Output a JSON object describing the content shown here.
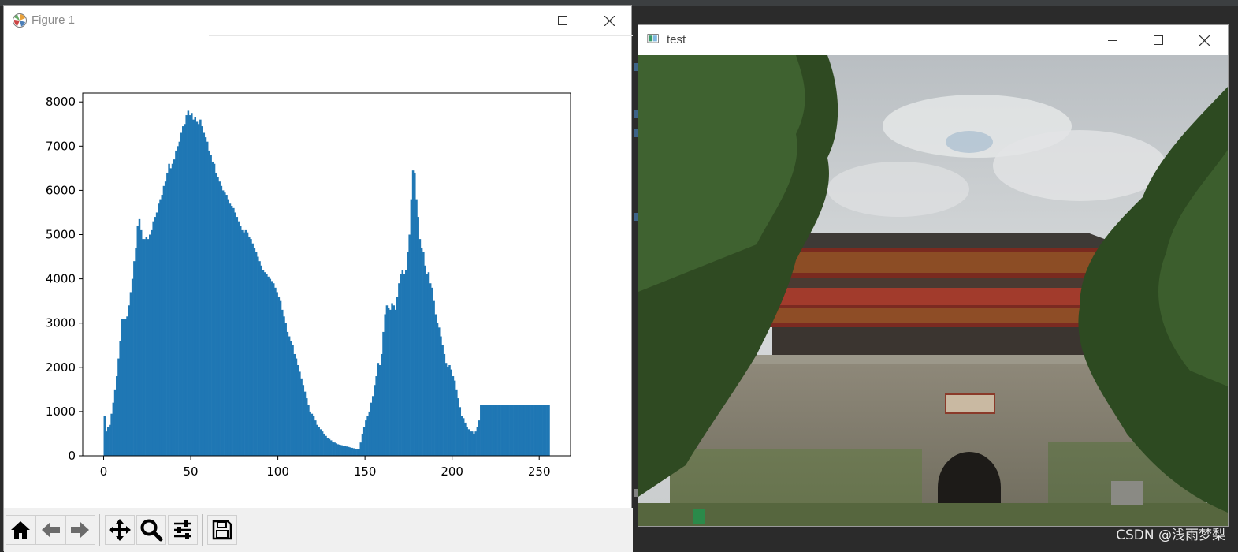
{
  "figure_window": {
    "title": "Figure 1",
    "icons": {
      "app": "matplotlib-logo-icon",
      "minimize": "minimize-icon",
      "maximize": "maximize-icon",
      "close": "close-icon"
    }
  },
  "toolbar": {
    "buttons": [
      "home-icon",
      "back-icon",
      "forward-icon",
      "pan-icon",
      "zoom-icon",
      "configure-subplots-icon",
      "save-icon"
    ]
  },
  "colors": {
    "bars": "#1f77b4",
    "ide_background": "#2b2b2b"
  },
  "chart_data": {
    "type": "bar",
    "title": "",
    "xlabel": "",
    "ylabel": "",
    "xlim": [
      -12,
      268
    ],
    "ylim": [
      0,
      8200
    ],
    "x_ticks": [
      "0",
      "50",
      "100",
      "150",
      "200",
      "250"
    ],
    "y_ticks": [
      "0",
      "1000",
      "2000",
      "3000",
      "4000",
      "5000",
      "6000",
      "7000",
      "8000"
    ],
    "grid": false,
    "legend": "none",
    "bin_width": 1,
    "x": [
      0,
      1,
      2,
      3,
      4,
      5,
      6,
      7,
      8,
      9,
      10,
      11,
      12,
      13,
      14,
      15,
      16,
      17,
      18,
      19,
      20,
      21,
      22,
      23,
      24,
      25,
      26,
      27,
      28,
      29,
      30,
      31,
      32,
      33,
      34,
      35,
      36,
      37,
      38,
      39,
      40,
      41,
      42,
      43,
      44,
      45,
      46,
      47,
      48,
      49,
      50,
      51,
      52,
      53,
      54,
      55,
      56,
      57,
      58,
      59,
      60,
      61,
      62,
      63,
      64,
      65,
      66,
      67,
      68,
      69,
      70,
      71,
      72,
      73,
      74,
      75,
      76,
      77,
      78,
      79,
      80,
      81,
      82,
      83,
      84,
      85,
      86,
      87,
      88,
      89,
      90,
      91,
      92,
      93,
      94,
      95,
      96,
      97,
      98,
      99,
      100,
      101,
      102,
      103,
      104,
      105,
      106,
      107,
      108,
      109,
      110,
      111,
      112,
      113,
      114,
      115,
      116,
      117,
      118,
      119,
      120,
      121,
      122,
      123,
      124,
      125,
      126,
      127,
      128,
      129,
      130,
      131,
      132,
      133,
      134,
      135,
      136,
      137,
      138,
      139,
      140,
      141,
      142,
      143,
      144,
      145,
      146,
      147,
      148,
      149,
      150,
      151,
      152,
      153,
      154,
      155,
      156,
      157,
      158,
      159,
      160,
      161,
      162,
      163,
      164,
      165,
      166,
      167,
      168,
      169,
      170,
      171,
      172,
      173,
      174,
      175,
      176,
      177,
      178,
      179,
      180,
      181,
      182,
      183,
      184,
      185,
      186,
      187,
      188,
      189,
      190,
      191,
      192,
      193,
      194,
      195,
      196,
      197,
      198,
      199,
      200,
      201,
      202,
      203,
      204,
      205,
      206,
      207,
      208,
      209,
      210,
      211,
      212,
      213,
      214,
      215,
      216,
      217,
      218,
      219,
      220,
      221,
      222,
      223,
      224,
      225,
      226,
      227,
      228,
      229,
      230,
      231,
      232,
      233,
      234,
      235,
      236,
      237,
      238,
      239,
      240,
      241,
      242,
      243,
      244,
      245,
      246,
      247,
      248,
      249,
      250,
      251,
      252,
      253,
      254,
      255
    ],
    "values": [
      900,
      550,
      650,
      700,
      950,
      1200,
      1500,
      1800,
      2200,
      2600,
      3100,
      3100,
      3100,
      3150,
      3400,
      3700,
      4000,
      4400,
      4700,
      5200,
      5350,
      5100,
      4900,
      4900,
      4950,
      4900,
      5000,
      5100,
      5300,
      5400,
      5500,
      5700,
      5800,
      5900,
      6100,
      6200,
      6400,
      6600,
      6500,
      6600,
      6700,
      6900,
      7000,
      7100,
      7300,
      7450,
      7500,
      7700,
      7800,
      7700,
      7750,
      7600,
      7650,
      7550,
      7500,
      7600,
      7450,
      7300,
      7200,
      7100,
      6900,
      6800,
      6650,
      6600,
      6400,
      6300,
      6200,
      6100,
      6000,
      5950,
      5900,
      5800,
      5700,
      5650,
      5600,
      5500,
      5400,
      5300,
      5200,
      5100,
      5050,
      5100,
      5050,
      4950,
      4900,
      4800,
      4700,
      4600,
      4500,
      4400,
      4300,
      4200,
      4150,
      4100,
      4050,
      4000,
      3950,
      3900,
      3800,
      3700,
      3600,
      3500,
      3300,
      3150,
      3000,
      2800,
      2700,
      2600,
      2500,
      2300,
      2200,
      2050,
      1900,
      1750,
      1600,
      1450,
      1300,
      1150,
      1000,
      950,
      900,
      800,
      700,
      650,
      600,
      550,
      500,
      450,
      400,
      380,
      350,
      320,
      300,
      280,
      260,
      250,
      240,
      230,
      220,
      210,
      200,
      190,
      180,
      170,
      160,
      150,
      150,
      300,
      500,
      650,
      800,
      900,
      1000,
      1200,
      1350,
      1600,
      1800,
      2100,
      2050,
      2300,
      2800,
      3200,
      3400,
      3350,
      3300,
      3450,
      3400,
      3300,
      3600,
      3900,
      4100,
      4200,
      4100,
      4200,
      4600,
      5000,
      5800,
      6450,
      6400,
      5800,
      5400,
      4900,
      4700,
      4600,
      4300,
      4100,
      4150,
      3900,
      3800,
      3500,
      3200,
      3000,
      2900,
      2700,
      2500,
      2300,
      2100,
      2000,
      2050,
      1950,
      1800,
      1700,
      1500,
      1300,
      1100,
      900,
      850,
      750,
      650,
      600,
      550,
      550,
      500,
      550,
      650,
      800,
      1150,
      1150,
      1150,
      1150,
      1150,
      1150,
      1150,
      1150,
      1150,
      1150,
      1150,
      1150,
      1150,
      1150,
      1150,
      1150,
      1150,
      1150,
      1150,
      1150,
      1150,
      1150,
      1150,
      1150,
      1150,
      1150,
      1150,
      1150,
      1150,
      1150,
      1150,
      1150,
      1150,
      1150,
      1150,
      1150,
      1150,
      1150,
      1150,
      1150,
      1150,
      1150,
      1150,
      1150,
      1150,
      1150,
      1150,
      1150,
      1150
    ]
  },
  "test_window": {
    "title": "test",
    "icons": {
      "app": "opencv-window-icon",
      "minimize": "minimize-icon",
      "maximize": "maximize-icon",
      "close": "close-icon"
    },
    "image": "photo-of-ancient-city-gate-tower"
  },
  "watermark": "CSDN @浅雨梦梨"
}
